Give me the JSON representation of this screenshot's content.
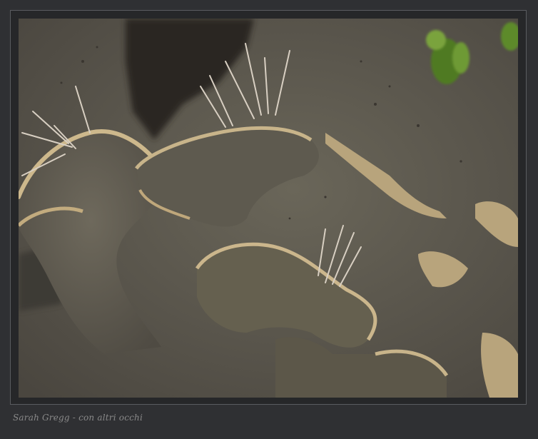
{
  "caption": {
    "text": "Sarah Gregg - con altri occhi"
  },
  "photo": {
    "subject": "lichen-macro"
  },
  "colors": {
    "page_background": "#2f3033",
    "frame_border": "#5a5c60",
    "caption_text": "#8a8a8a",
    "lichen_dark": "#4e4a42",
    "lichen_mid": "#6f6a5d",
    "lichen_edge": "#c8b48a",
    "moss_green": "#5e8a2c"
  }
}
